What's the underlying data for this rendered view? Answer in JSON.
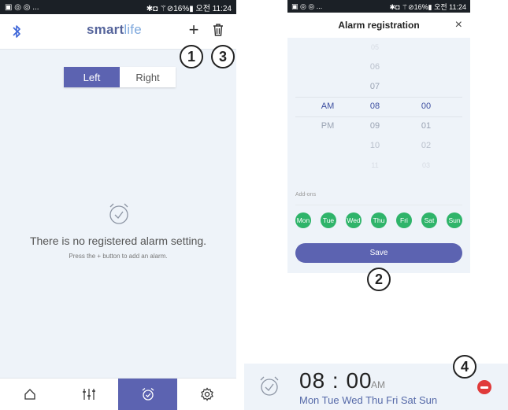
{
  "left_screen": {
    "status_bar": {
      "left_icons": "▣ ◎ ◎ ...",
      "right_text": "✱◘ ⚚⊘16%▮ 오전 11:24"
    },
    "app_bar": {
      "brand_bold": "smart",
      "brand_light": "life",
      "add_label": "+",
      "bluetooth_icon": "bluetooth-icon",
      "trash_icon": "trash-icon"
    },
    "segmented": {
      "left": "Left",
      "right": "Right",
      "selected": "Left"
    },
    "empty_state": {
      "title": "There is no registered alarm setting.",
      "subtitle": "Press the + button to add an alarm."
    },
    "bottom_nav": [
      "home-icon",
      "equalizer-icon",
      "alarm-icon",
      "settings-icon"
    ],
    "bottom_nav_active": "alarm-icon"
  },
  "callouts": {
    "c1": "1",
    "c2": "2",
    "c3": "3",
    "c4": "4"
  },
  "right_screen": {
    "status_bar": {
      "left_icons": "▣ ◎ ◎ ...",
      "right_text": "✱◘ ⚚⊘16%▮ 오전 11:24"
    },
    "title": "Alarm registration",
    "close_label": "×",
    "picker": {
      "rows": [
        {
          "ampm": "",
          "hour": "05",
          "minute": ""
        },
        {
          "ampm": "",
          "hour": "06",
          "minute": ""
        },
        {
          "ampm": "",
          "hour": "07",
          "minute": ""
        },
        {
          "ampm": "AM",
          "hour": "08",
          "minute": "00"
        },
        {
          "ampm": "PM",
          "hour": "09",
          "minute": "01"
        },
        {
          "ampm": "",
          "hour": "10",
          "minute": "02"
        },
        {
          "ampm": "",
          "hour": "11",
          "minute": "03"
        }
      ],
      "selected_index": 3
    },
    "addons_label": "Add-ons",
    "days": [
      "Mon",
      "Tue",
      "Wed",
      "Thu",
      "Fri",
      "Sat",
      "Sun"
    ],
    "save_label": "Save",
    "colors": {
      "accent": "#5c63b1",
      "day_chip": "#2fb46a"
    }
  },
  "alarm_item": {
    "time": "08 : 00",
    "ampm": "AM",
    "days": "Mon Tue Wed Thu Fri Sat Sun",
    "remove_icon": "remove-icon",
    "remove_color": "#e03a3a"
  }
}
